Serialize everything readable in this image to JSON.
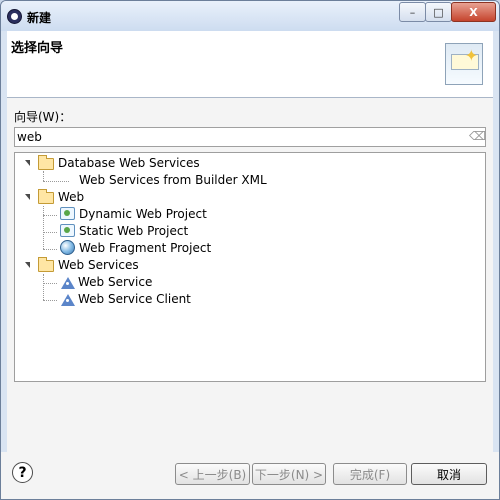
{
  "window": {
    "title": "新建",
    "controls": {
      "minimize": "–",
      "maximize": "□",
      "close": "X"
    }
  },
  "header": {
    "title": "选择向导"
  },
  "filter": {
    "label": "向导(W)：",
    "mnemonic": "W",
    "value": "web"
  },
  "tree": {
    "items": [
      {
        "label": "Database Web Services",
        "type": "folder"
      },
      {
        "label": "Web Services from Builder XML",
        "type": "leaf"
      },
      {
        "label": "Web",
        "type": "folder"
      },
      {
        "label": "Dynamic Web Project",
        "type": "web-project"
      },
      {
        "label": "Static Web Project",
        "type": "web-project"
      },
      {
        "label": "Web Fragment Project",
        "type": "globe"
      },
      {
        "label": "Web Services",
        "type": "folder"
      },
      {
        "label": "Web Service",
        "type": "service"
      },
      {
        "label": "Web Service Client",
        "type": "service"
      }
    ]
  },
  "buttons": {
    "back": "< 上一步(B)",
    "next": "下一步(N) >",
    "finish": "完成(F)",
    "cancel": "取消"
  },
  "icons": {
    "app": "eclipse-icon",
    "header": "wizard-banner-icon",
    "clear": "eraser-icon",
    "help": "help-icon"
  }
}
